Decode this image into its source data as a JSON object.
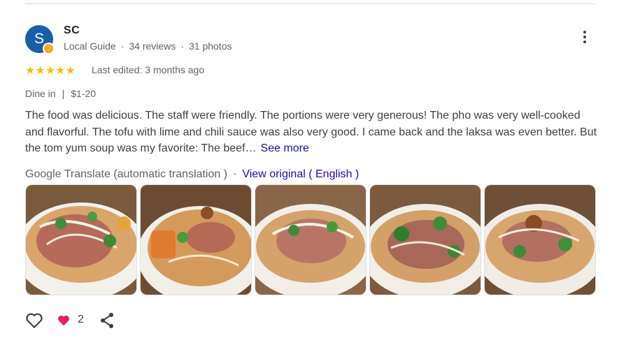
{
  "reviewer": {
    "initial": "S",
    "name": "SC",
    "badge": "Local Guide",
    "reviews": "34 reviews",
    "photos": "31 photos"
  },
  "rating": {
    "stars_text": "★★★★★",
    "value": 5,
    "max": 5
  },
  "edited": "Last edited: 3 months ago",
  "dining": {
    "mode": "Dine in",
    "sep": "|",
    "price": "$1-20"
  },
  "review_text": "The food was delicious. The staff were friendly. The portions were very generous! The pho was very well-cooked and flavorful. The tofu with lime and chili sauce was also very good. I came back and the laksa was even better. But the tom yum soup was my favorite: The beef…",
  "see_more": "See more",
  "translation": {
    "label": "Google Translate (automatic translation )",
    "dot": "·",
    "view_original": "View original ( English )"
  },
  "photos": [
    {
      "alt": "pho bowl with herbs and beef"
    },
    {
      "alt": "soup with tofu and bean sprouts"
    },
    {
      "alt": "noodle soup with onions"
    },
    {
      "alt": "beef pho with greens"
    },
    {
      "alt": "soup with fried shallots"
    }
  ],
  "actions": {
    "like_icon": "heart-outline-icon",
    "reaction_icon": "heart-filled-icon",
    "reaction_count": "2",
    "share_icon": "share-icon"
  },
  "colors": {
    "avatar": "#1a5ea8",
    "stars": "#fbbc04",
    "link": "#1a0dab",
    "reaction": "#e91e63"
  }
}
